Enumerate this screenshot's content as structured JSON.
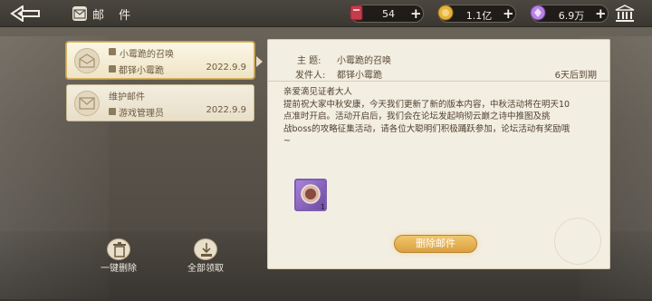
{
  "header": {
    "title": "邮 件",
    "back_icon": "back-arrow-icon",
    "mail_icon": "mail-icon",
    "resources": [
      {
        "icon": "ticket-icon",
        "value": "54",
        "color": "#c43c4c"
      },
      {
        "icon": "gold-coin-icon",
        "value": "1.1亿",
        "color": "#e6b23d"
      },
      {
        "icon": "crystal-icon",
        "value": "6.9万",
        "color": "#b783e0"
      }
    ],
    "bank_icon": "bank-icon"
  },
  "mail_list": [
    {
      "title": "小霉跪的召唤",
      "sender": "都铎小霉跪",
      "date": "2022.9.9",
      "selected": true
    },
    {
      "title": "维护邮件",
      "sender": "游戏管理员",
      "date": "2022.9.9",
      "selected": false
    }
  ],
  "detail": {
    "subject_label": "主    题:",
    "subject": "小霉跪的召唤",
    "sender_label": "发件人:",
    "sender": "都铎小霉跪",
    "expiry": "6天后到期",
    "body_line1": "亲爱滴见证者大人",
    "body_line2": "提前祝大家中秋安康，今天我们更新了新的版本内容，中秋活动将在明天10",
    "body_line3": "点准时开启。活动开启后，我们会在论坛发起响彻云巅之诗中推图及挑",
    "body_line4": "战boss的攻略征集活动，请各位大聪明们积极踊跃参加，论坛活动有奖励哦",
    "body_line5": "~",
    "attachment_count": "1",
    "delete_button": "删除邮件"
  },
  "actions": {
    "delete_all": "一键删除",
    "claim_all": "全部领取"
  }
}
